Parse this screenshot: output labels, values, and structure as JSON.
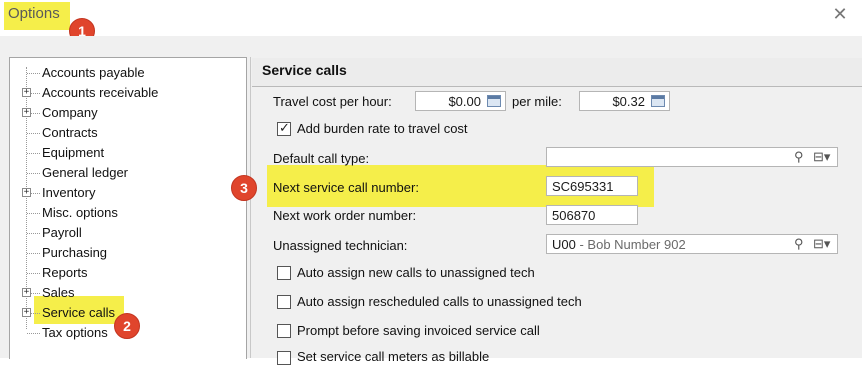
{
  "window": {
    "title": "Options",
    "close_glyph": "✕"
  },
  "badges": [
    "1",
    "2",
    "3"
  ],
  "tree": {
    "items": [
      {
        "label": "Accounts payable",
        "expandable": false
      },
      {
        "label": "Accounts receivable",
        "expandable": true
      },
      {
        "label": "Company",
        "expandable": true
      },
      {
        "label": "Contracts",
        "expandable": false
      },
      {
        "label": "Equipment",
        "expandable": false
      },
      {
        "label": "General ledger",
        "expandable": false
      },
      {
        "label": "Inventory",
        "expandable": true
      },
      {
        "label": "Misc. options",
        "expandable": false
      },
      {
        "label": "Payroll",
        "expandable": false
      },
      {
        "label": "Purchasing",
        "expandable": false
      },
      {
        "label": "Reports",
        "expandable": false
      },
      {
        "label": "Sales",
        "expandable": true
      },
      {
        "label": "Service calls",
        "expandable": true,
        "selected": true
      },
      {
        "label": "Tax options",
        "expandable": false
      }
    ],
    "expander_glyph": "+"
  },
  "panel": {
    "title": "Service calls",
    "travel_cost_label": "Travel cost per hour:",
    "travel_cost_value": "$0.00",
    "per_mile_label": "per mile:",
    "per_mile_value": "$0.32",
    "add_burden_label": "Add burden rate to travel cost",
    "add_burden_checked": true,
    "default_call_type_label": "Default call type:",
    "default_call_type_value": "",
    "next_service_call_label": "Next service call number:",
    "next_service_call_value": "SC695331",
    "next_work_order_label": "Next work order number:",
    "next_work_order_value": "506870",
    "unassigned_tech_label": "Unassigned technician:",
    "unassigned_tech_code": "U00",
    "unassigned_tech_name": " - Bob Number 902",
    "auto_assign_new_label": "Auto assign new calls to unassigned tech",
    "auto_assign_rescheduled_label": "Auto assign rescheduled calls to unassigned tech",
    "prompt_before_saving_label": "Prompt before saving invoiced service call",
    "set_meters_label": "Set service call meters as billable",
    "checkmark_glyph": "✓",
    "search_glyph": "⚲",
    "lookup_glyph": "⊟▾"
  },
  "colors": {
    "highlight": "#f5ee4a",
    "badge": "#e0452c"
  }
}
